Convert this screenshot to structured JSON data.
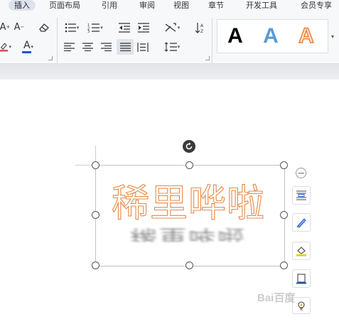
{
  "tabs": {
    "items": [
      "插入",
      "页面布局",
      "引用",
      "审阅",
      "视图",
      "章节",
      "开发工具",
      "会员专享"
    ],
    "active": "插入"
  },
  "ribbon": {
    "font_color_accent": "#1a56d6",
    "style_gallery": {
      "letters": [
        "A",
        "A",
        "A"
      ],
      "styles": [
        "black",
        "blue",
        "orange-outline"
      ]
    }
  },
  "document": {
    "art_text": "稀里哗啦",
    "art_text_color": "#e88a44",
    "reflection_text": "稀里哗啦"
  },
  "watermark": "Bai百度"
}
